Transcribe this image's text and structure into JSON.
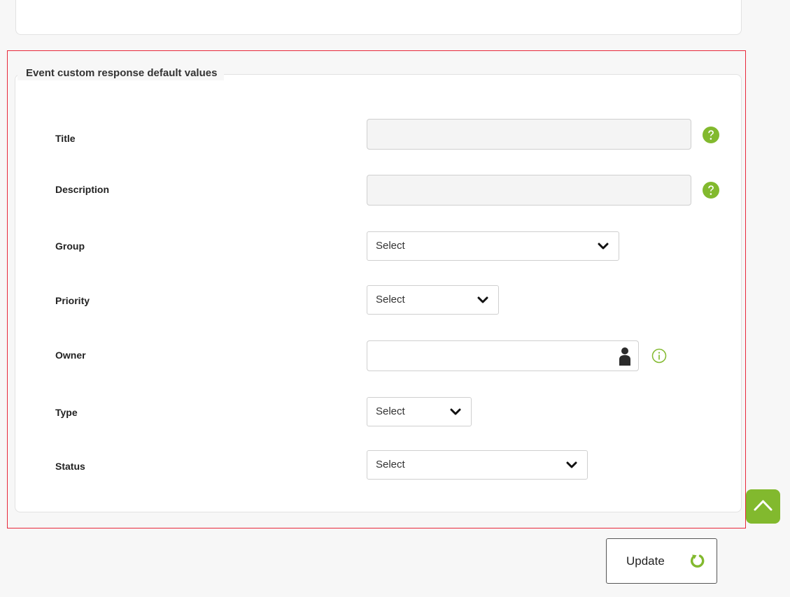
{
  "section": {
    "legend": "Event custom response default values"
  },
  "fields": {
    "title": {
      "label": "Title",
      "value": ""
    },
    "description": {
      "label": "Description",
      "value": ""
    },
    "group": {
      "label": "Group",
      "selected": "Select"
    },
    "priority": {
      "label": "Priority",
      "selected": "Select"
    },
    "owner": {
      "label": "Owner",
      "value": ""
    },
    "type": {
      "label": "Type",
      "selected": "Select"
    },
    "status": {
      "label": "Status",
      "selected": "Select"
    }
  },
  "actions": {
    "update_label": "Update"
  },
  "icons": {
    "help": "help-icon",
    "info": "info-icon",
    "user": "user-icon",
    "scroll_top": "chevron-up-icon",
    "refresh": "refresh-icon"
  },
  "colors": {
    "accent_green": "#82b92e",
    "highlight_red": "#e8283a"
  }
}
